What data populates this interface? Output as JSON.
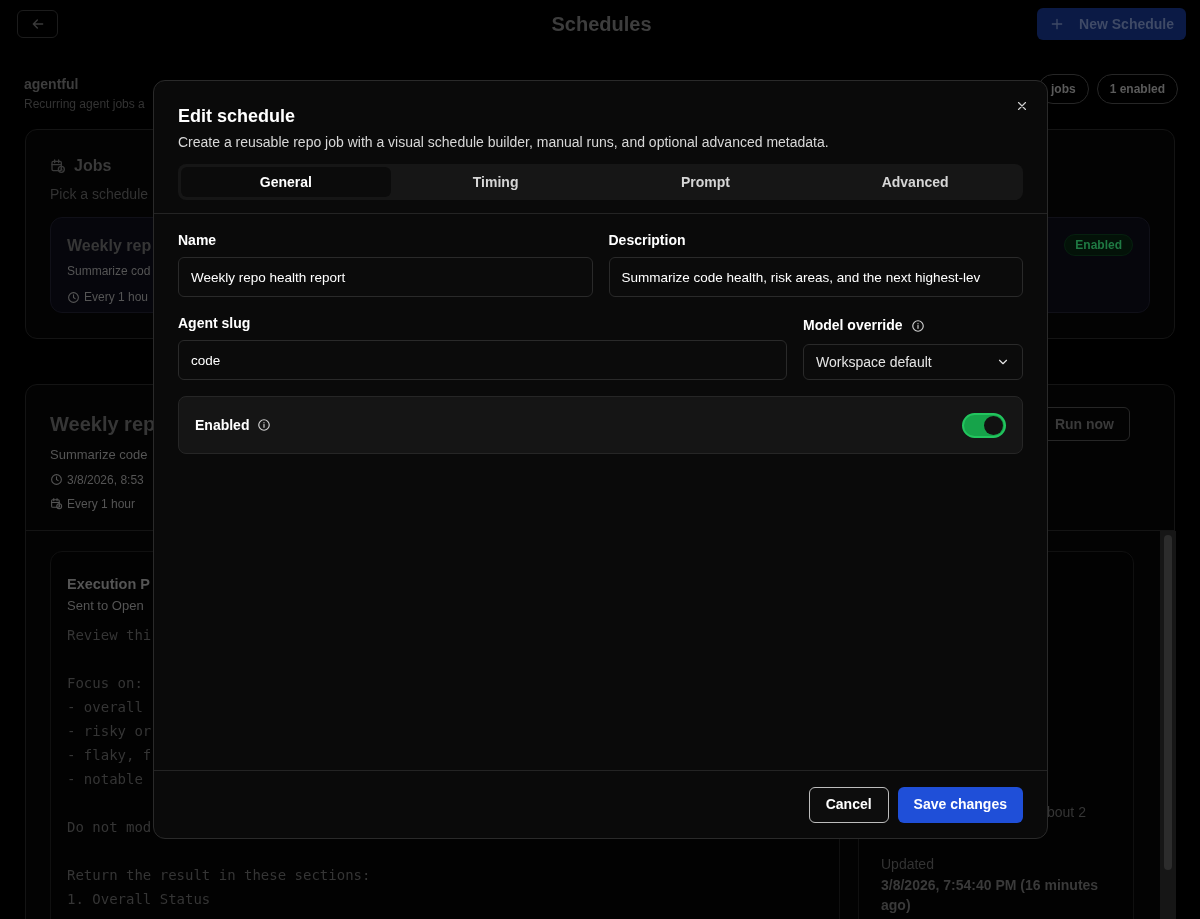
{
  "header": {
    "title": "Schedules",
    "new_button": "New Schedule"
  },
  "workspace": {
    "name": "agentful",
    "subtitle": "Recurring agent jobs a",
    "badges": [
      "jobs",
      "1 enabled"
    ]
  },
  "jobs_card": {
    "title": "Jobs",
    "subtitle": "Pick a schedule",
    "items": [
      {
        "name": "Weekly rep",
        "description": "Summarize cod",
        "frequency": "Every 1 hou",
        "status": "Enabled"
      }
    ]
  },
  "detail": {
    "title": "Weekly rep",
    "description": "Summarize code",
    "next_run": "3/8/2026, 8:53",
    "frequency": "Every 1 hour",
    "run_button": "Run now"
  },
  "execution": {
    "title": "Execution P",
    "subtitle": "Sent to Open",
    "prompt_paragraphs": [
      [
        "Review thi"
      ],
      [
        "Focus on:",
        "- overall",
        "- risky or",
        "- flaky, f",
        "- notable"
      ],
      [
        "Do not mod"
      ],
      [
        "Return the result in these sections:",
        "1. Overall Status"
      ]
    ]
  },
  "meta": {
    "partial_text": "bout 2",
    "updated_label": "Updated",
    "updated_value": "3/8/2026, 7:54:40 PM (16 minutes ago)"
  },
  "dialog": {
    "title": "Edit schedule",
    "description": "Create a reusable repo job with a visual schedule builder, manual runs, and optional advanced metadata.",
    "tabs": [
      {
        "label": "General",
        "selected": true
      },
      {
        "label": "Timing",
        "selected": false
      },
      {
        "label": "Prompt",
        "selected": false
      },
      {
        "label": "Advanced",
        "selected": false
      }
    ],
    "name": {
      "label": "Name",
      "value": "Weekly repo health report"
    },
    "description_field": {
      "label": "Description",
      "value": "Summarize code health, risk areas, and the next highest-lev"
    },
    "agent_slug": {
      "label": "Agent slug",
      "value": "code"
    },
    "model_override": {
      "label": "Model override",
      "value": "Workspace default"
    },
    "enabled": {
      "label": "Enabled",
      "on": true
    },
    "buttons": {
      "cancel": "Cancel",
      "save": "Save changes"
    }
  }
}
